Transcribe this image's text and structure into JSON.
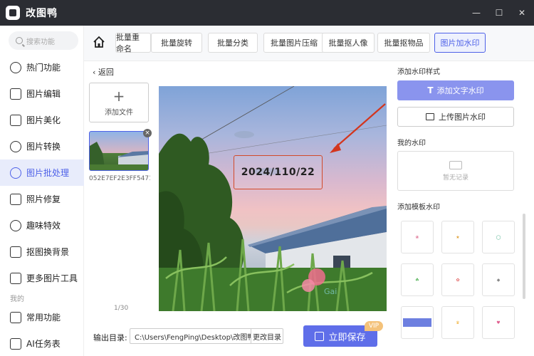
{
  "app": {
    "title": "改图鸭"
  },
  "window": {
    "minimize": "—",
    "maximize": "☐",
    "close": "✕"
  },
  "sidebar": {
    "search_placeholder": "搜索功能",
    "items": [
      {
        "label": "热门功能",
        "icon": "flame-icon"
      },
      {
        "label": "图片编辑",
        "icon": "image-edit-icon"
      },
      {
        "label": "图片美化",
        "icon": "beautify-icon"
      },
      {
        "label": "图片转换",
        "icon": "convert-icon"
      },
      {
        "label": "图片批处理",
        "icon": "batch-icon",
        "active": true
      },
      {
        "label": "照片修复",
        "icon": "repair-icon"
      },
      {
        "label": "趣味特效",
        "icon": "sparkle-icon"
      },
      {
        "label": "抠图换背景",
        "icon": "crop-icon"
      },
      {
        "label": "更多图片工具",
        "icon": "toolbox-icon"
      }
    ],
    "section_mine": "我的",
    "mine_items": [
      {
        "label": "常用功能",
        "icon": "grid-icon"
      },
      {
        "label": "AI任务表",
        "icon": "ai-icon"
      }
    ]
  },
  "tabs": [
    {
      "label": "批量重命名"
    },
    {
      "label": "批量旋转"
    },
    {
      "label": "批量分类"
    },
    {
      "label": "批量图片压缩"
    },
    {
      "label": "批量抠人像"
    },
    {
      "label": "批量抠物品"
    },
    {
      "label": "图片加水印",
      "active": true
    }
  ],
  "files": {
    "back_label": "返回",
    "add_file_label": "添加文件",
    "thumb_name": "052E7EF2E3FF5471...",
    "page_count": "1/30"
  },
  "preview": {
    "watermark_text": "2024/110/22"
  },
  "bottom": {
    "output_label": "输出目录:",
    "output_path": "C:\\Users\\FengPing\\Desktop\\改图鸭",
    "change_dir": "更改目录",
    "save_label": "立即保存",
    "vip": "VIP"
  },
  "right_panel": {
    "style_heading": "添加水印样式",
    "add_text_wm": "添加文字水印",
    "add_img_wm": "上传图片水印",
    "my_wm_heading": "我的水印",
    "my_wm_empty": "暂无记录",
    "template_heading": "添加模板水印"
  },
  "colors": {
    "accent": "#4e61e8",
    "titlebar": "#2b2d33",
    "stamp_border": "#d24a2a"
  }
}
